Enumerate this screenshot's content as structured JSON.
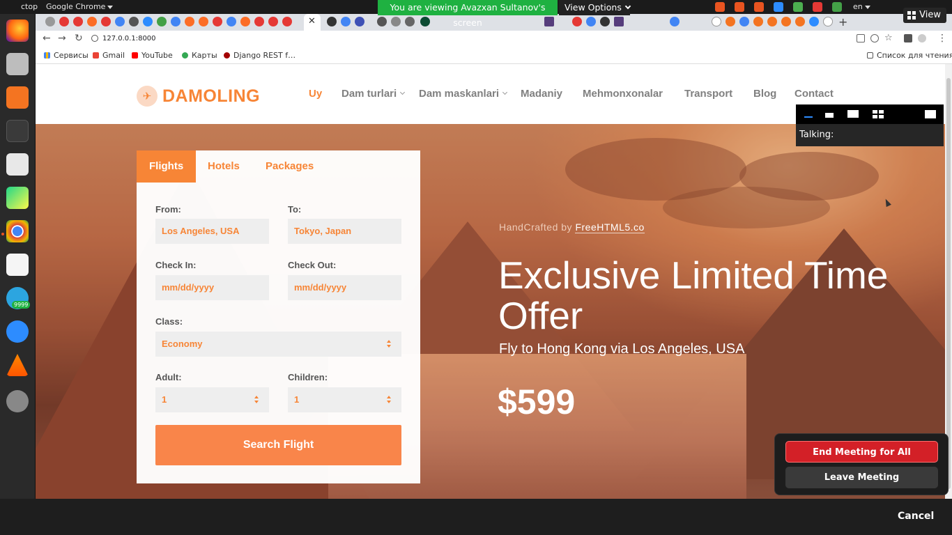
{
  "system_bar": {
    "activities_label": "ctop",
    "app_menu_label": "Google Chrome",
    "language": "en"
  },
  "share": {
    "banner_text": "You are viewing Avazxan Sultanov's screen",
    "view_options_label": "View Options",
    "view_button_label": "View"
  },
  "dock": {
    "telegram_badge": "9999",
    "apps": [
      "firefox-icon",
      "files-icon",
      "software-store-icon",
      "terminal-icon",
      "text-editor-icon",
      "pycharm-icon",
      "chrome-icon",
      "document-viewer-icon",
      "telegram-icon",
      "zoom-icon",
      "vlc-icon",
      "disk-icon"
    ]
  },
  "browser": {
    "url": "127.0.0.1:8000",
    "active_tab_close": "✕",
    "new_tab": "+",
    "bookmarks": [
      "Сервисы",
      "Gmail",
      "YouTube",
      "Карты",
      "Django REST f…"
    ],
    "reading_list": "Список для чтения"
  },
  "site": {
    "logo_text": "DAMOLING",
    "nav": [
      {
        "label": "Uy",
        "active": true
      },
      {
        "label": "Dam turlari",
        "dropdown": true
      },
      {
        "label": "Dam maskanlari",
        "dropdown": true
      },
      {
        "label": "Madaniy"
      },
      {
        "label": "Mehmonxonalar"
      },
      {
        "label": "Transport"
      },
      {
        "label": "Blog"
      },
      {
        "label": "Contact"
      }
    ],
    "booking": {
      "tabs": [
        "Flights",
        "Hotels",
        "Packages"
      ],
      "active_tab": "Flights",
      "from_label": "From:",
      "from_value": "Los Angeles, USA",
      "to_label": "To:",
      "to_value": "Tokyo, Japan",
      "checkin_label": "Check In:",
      "checkin_placeholder": "mm/dd/yyyy",
      "checkout_label": "Check Out:",
      "checkout_placeholder": "mm/dd/yyyy",
      "class_label": "Class:",
      "class_value": "Economy",
      "adult_label": "Adult:",
      "adult_value": "1",
      "children_label": "Children:",
      "children_value": "1",
      "search_button": "Search Flight"
    },
    "hero": {
      "credit_prefix": "HandCrafted by",
      "credit_link": "FreeHTML5.co",
      "headline": "Exclusive Limited Time Offer",
      "subline": "Fly to Hong Kong via Los Angeles, USA",
      "price": "$599"
    }
  },
  "meeting": {
    "talking_label": "Talking:",
    "end_all_label": "End Meeting for All",
    "leave_label": "Leave Meeting",
    "cancel_label": "Cancel"
  },
  "colors": {
    "brand_orange": "#f78536",
    "share_green": "#1fb141",
    "end_red": "#d32027"
  }
}
